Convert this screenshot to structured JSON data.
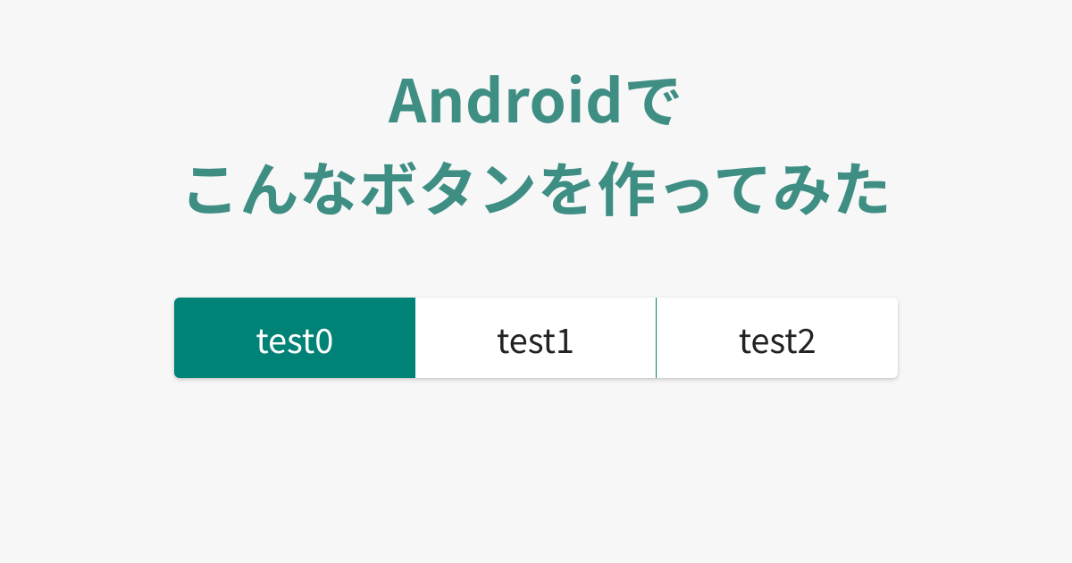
{
  "title": {
    "line1": "Androidで",
    "line2": "こんなボタンを作ってみた"
  },
  "segments": [
    {
      "label": "test0",
      "active": true
    },
    {
      "label": "test1",
      "active": false
    },
    {
      "label": "test2",
      "active": false
    }
  ],
  "colors": {
    "titleColor": "#3e8e84",
    "segmentActive": "#008376",
    "background": "#f7f7f7"
  }
}
